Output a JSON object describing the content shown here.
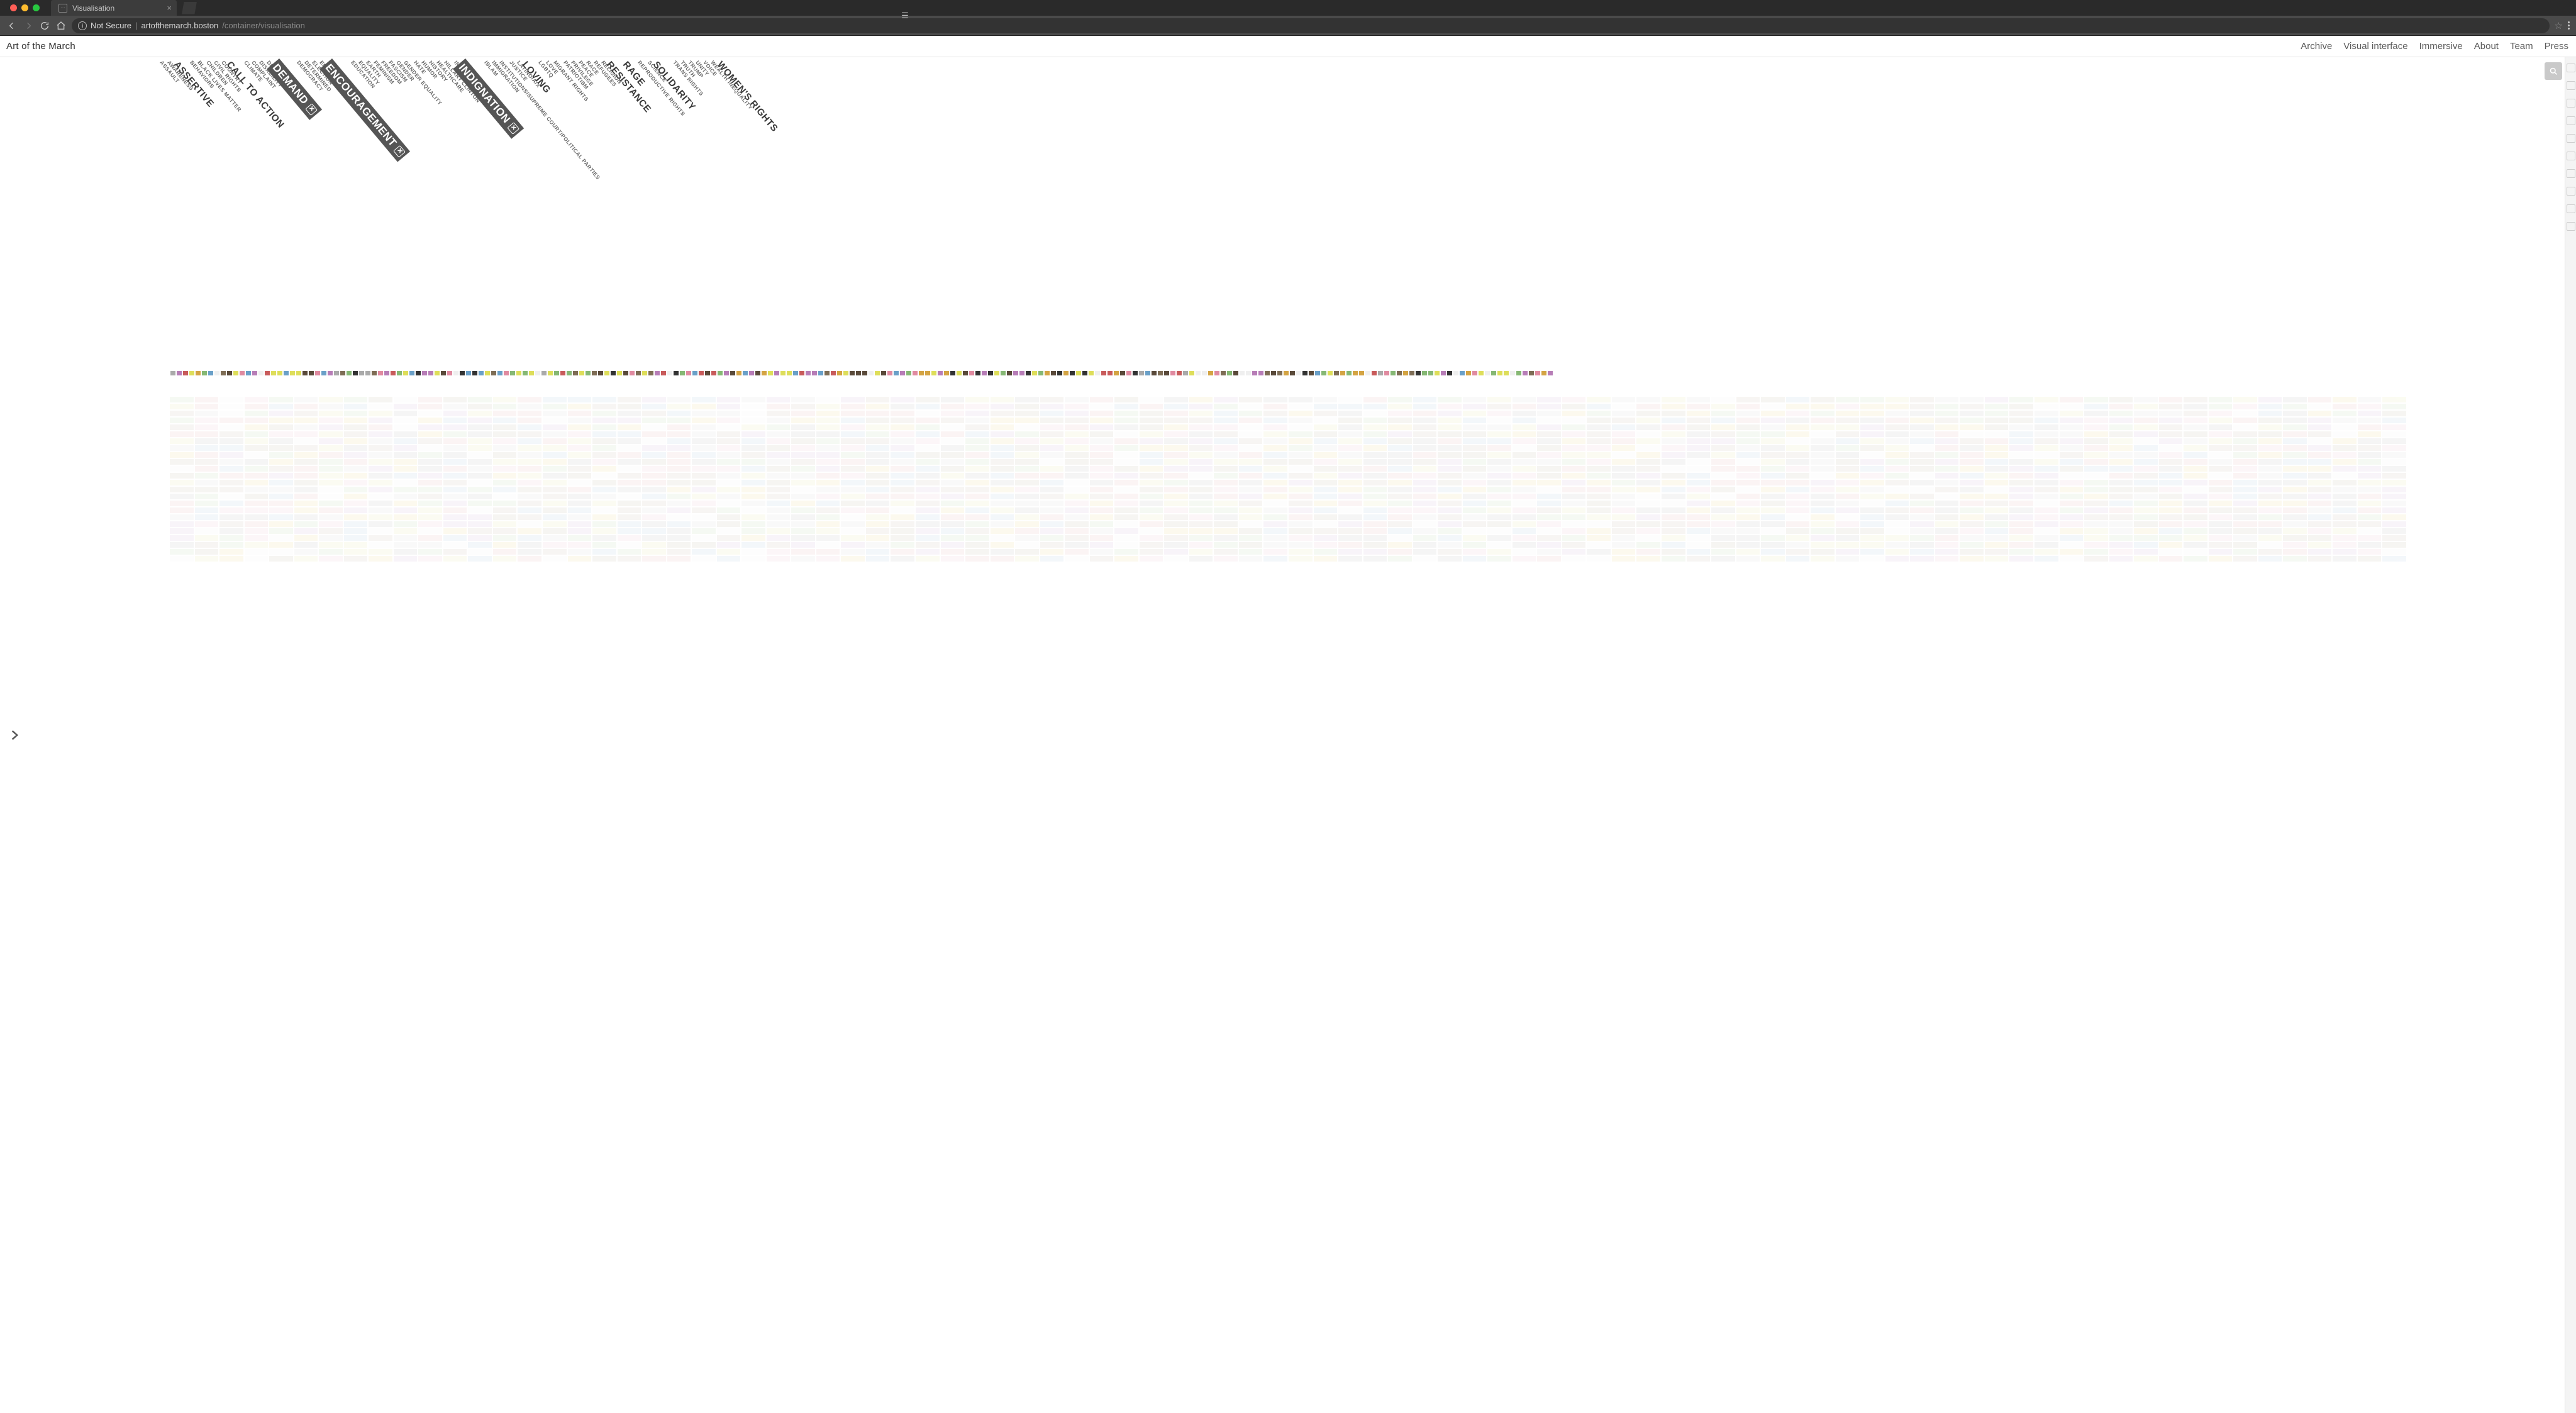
{
  "browser": {
    "tab_title": "Visualisation",
    "security_label": "Not Secure",
    "url_host": "artofthemarch.boston",
    "url_path": "/container/visualisation"
  },
  "site": {
    "title": "Art of the March",
    "nav": [
      "Archive",
      "Visual interface",
      "Immersive",
      "About",
      "Team",
      "Press"
    ]
  },
  "categories": [
    {
      "label": "ASSAULT",
      "pos": 0,
      "kind": "plain"
    },
    {
      "label": "AWARENESS",
      "pos": 12,
      "kind": "plain"
    },
    {
      "label": "ASSERTIVE",
      "pos": 26,
      "kind": "emph"
    },
    {
      "label": "BEHAVIORS",
      "pos": 48,
      "kind": "plain"
    },
    {
      "label": "BLACK LIVES MATTER",
      "pos": 60,
      "kind": "plain"
    },
    {
      "label": "CHILDREN",
      "pos": 74,
      "kind": "plain"
    },
    {
      "label": "CIVIL RIGHTS",
      "pos": 86,
      "kind": "plain"
    },
    {
      "label": "COUNTRY",
      "pos": 98,
      "kind": "plain"
    },
    {
      "label": "CALL TO ACTION",
      "pos": 110,
      "kind": "emph"
    },
    {
      "label": "CLIMATE",
      "pos": 134,
      "kind": "plain"
    },
    {
      "label": "COMPLAINT",
      "pos": 146,
      "kind": "plain"
    },
    {
      "label": "DISABILITY",
      "pos": 158,
      "kind": "plain"
    },
    {
      "label": "DIVERSITY",
      "pos": 170,
      "kind": "plain"
    },
    {
      "label": "DEMAND",
      "pos": 184,
      "kind": "selected"
    },
    {
      "label": "DEMOCRACY",
      "pos": 218,
      "kind": "plain"
    },
    {
      "label": "DETERMINED",
      "pos": 230,
      "kind": "plain"
    },
    {
      "label": "ELECTION",
      "pos": 242,
      "kind": "plain"
    },
    {
      "label": "ENVIRONMENT",
      "pos": 254,
      "kind": "plain"
    },
    {
      "label": "ENCOURAGEMENT",
      "pos": 268,
      "kind": "selected"
    },
    {
      "label": "EDUCATION",
      "pos": 304,
      "kind": "plain"
    },
    {
      "label": "EQUALITY",
      "pos": 316,
      "kind": "plain"
    },
    {
      "label": "EARTH",
      "pos": 328,
      "kind": "plain"
    },
    {
      "label": "FEMINISM",
      "pos": 340,
      "kind": "plain"
    },
    {
      "label": "FREEDOM",
      "pos": 352,
      "kind": "plain"
    },
    {
      "label": "FASCISM",
      "pos": 364,
      "kind": "plain"
    },
    {
      "label": "GENDER",
      "pos": 376,
      "kind": "plain"
    },
    {
      "label": "GENDER EQUALITY",
      "pos": 388,
      "kind": "plain"
    },
    {
      "label": "HATE",
      "pos": 404,
      "kind": "plain"
    },
    {
      "label": "HUMOR",
      "pos": 416,
      "kind": "plain"
    },
    {
      "label": "HISTORY",
      "pos": 428,
      "kind": "plain"
    },
    {
      "label": "HEALTHCARE",
      "pos": 440,
      "kind": "plain"
    },
    {
      "label": "HILLARY CLINTON",
      "pos": 452,
      "kind": "plain"
    },
    {
      "label": "INSULTS",
      "pos": 468,
      "kind": "plain"
    },
    {
      "label": "INDIGNATION",
      "pos": 480,
      "kind": "selected"
    },
    {
      "label": "ISLAM",
      "pos": 516,
      "kind": "plain"
    },
    {
      "label": "IMMIGRATION",
      "pos": 528,
      "kind": "plain"
    },
    {
      "label": "INSTITUTIONS/SUPREME COURT/POLITICAL PARTIES",
      "pos": 540,
      "kind": "plain"
    },
    {
      "label": "JUSTICE",
      "pos": 556,
      "kind": "plain"
    },
    {
      "label": "LATINO/A/X",
      "pos": 568,
      "kind": "plain"
    },
    {
      "label": "LOVING",
      "pos": 580,
      "kind": "emph"
    },
    {
      "label": "LGBTQ",
      "pos": 602,
      "kind": "plain"
    },
    {
      "label": "LOVE",
      "pos": 614,
      "kind": "plain"
    },
    {
      "label": "MIGRANT RIGHTS",
      "pos": 626,
      "kind": "plain"
    },
    {
      "label": "PATRIOTISM",
      "pos": 642,
      "kind": "plain"
    },
    {
      "label": "PRIVILEGE",
      "pos": 654,
      "kind": "plain"
    },
    {
      "label": "PEACE",
      "pos": 666,
      "kind": "plain"
    },
    {
      "label": "RACE",
      "pos": 678,
      "kind": "plain"
    },
    {
      "label": "REFUGEES",
      "pos": 690,
      "kind": "plain"
    },
    {
      "label": "RELIGION",
      "pos": 702,
      "kind": "plain"
    },
    {
      "label": "RESISTANCE",
      "pos": 714,
      "kind": "emph"
    },
    {
      "label": "RAGE",
      "pos": 740,
      "kind": "emph"
    },
    {
      "label": "REPRODUCTIVE RIGHTS",
      "pos": 760,
      "kind": "plain"
    },
    {
      "label": "SCIENCE",
      "pos": 776,
      "kind": "plain"
    },
    {
      "label": "SOLIDARITY",
      "pos": 788,
      "kind": "emph"
    },
    {
      "label": "TRANS RIGHTS",
      "pos": 816,
      "kind": "plain"
    },
    {
      "label": "TRUTH",
      "pos": 828,
      "kind": "plain"
    },
    {
      "label": "TRUMP",
      "pos": 840,
      "kind": "plain"
    },
    {
      "label": "UNITY",
      "pos": 852,
      "kind": "plain"
    },
    {
      "label": "VOICE",
      "pos": 864,
      "kind": "plain"
    },
    {
      "label": "WEALTH INEQUALITY",
      "pos": 876,
      "kind": "plain"
    },
    {
      "label": "WOMEN'S RIGHTS",
      "pos": 890,
      "kind": "emph"
    }
  ],
  "thumb_palette": [
    "#c85b5b",
    "#d4a443",
    "#dede5a",
    "#86b874",
    "#6aa0c8",
    "#b77db7",
    "#aaaaaa",
    "#5a4a3a",
    "#efefef",
    "#e08aa0",
    "#7e6d55",
    "#333333"
  ],
  "grid_palette": [
    "#efc9c9",
    "#f2e2b0",
    "#edeec0",
    "#cfe5c6",
    "#c6d8ea",
    "#e1cde6",
    "#e6e6e6",
    "#d6cfc3",
    "#f6f6f6",
    "#f3d6df",
    "#d9d2c4",
    "#cfcfcf"
  ]
}
